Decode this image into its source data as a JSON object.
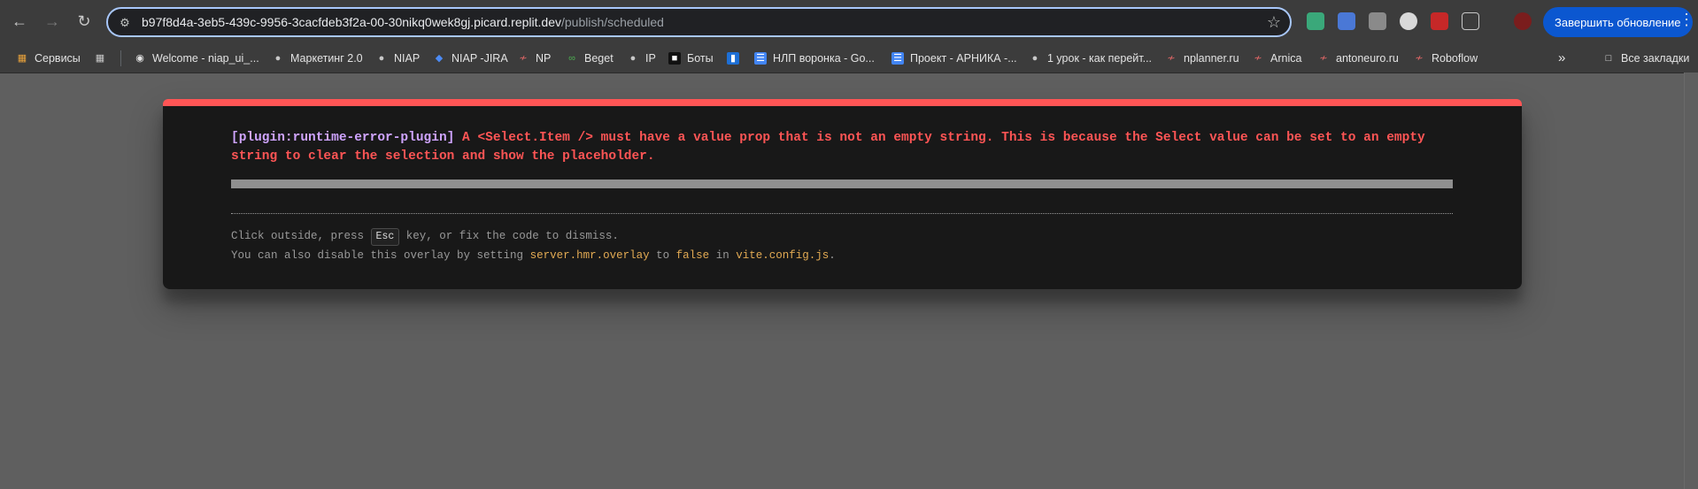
{
  "browser": {
    "url_host": "b97f8d4a-3eb5-439c-9956-3cacfdeb3f2a-00-30nikq0wek8gj.picard.replit.dev",
    "url_path": "/publish/scheduled",
    "update_button": "Завершить обновление"
  },
  "bookmarks": [
    {
      "label": "Сервисы",
      "icon": "apps-grid-icon"
    },
    {
      "label": "",
      "icon": "grid-icon"
    },
    {
      "label": "Welcome - niap_ui_...",
      "icon": "github-icon"
    },
    {
      "label": "Маркетинг 2.0",
      "icon": "globe-icon"
    },
    {
      "label": "NIAP",
      "icon": "globe-icon"
    },
    {
      "label": "NIAP -JIRA",
      "icon": "jira-icon"
    },
    {
      "label": "NP",
      "icon": "link-icon"
    },
    {
      "label": "Beget",
      "icon": "beget-icon"
    },
    {
      "label": "IP",
      "icon": "globe-icon"
    },
    {
      "label": "Боты",
      "icon": "bots-icon"
    },
    {
      "label": "",
      "icon": "trello-icon"
    },
    {
      "label": "НЛП воронка - Go...",
      "icon": "docs-icon"
    },
    {
      "label": "Проект - АРНИКА -...",
      "icon": "docs-icon"
    },
    {
      "label": "1 урок - как перейт...",
      "icon": "globe-icon"
    },
    {
      "label": "nplanner.ru",
      "icon": "link-icon"
    },
    {
      "label": "Arnica",
      "icon": "link-icon"
    },
    {
      "label": "antoneuro.ru",
      "icon": "link-icon"
    },
    {
      "label": "Roboflow",
      "icon": "link-icon"
    }
  ],
  "all_bookmarks": "Все закладки",
  "error_overlay": {
    "plugin": "[plugin:runtime-error-plugin]",
    "message": "A <Select.Item /> must have a value prop that is not an empty string. This is because the Select value can be set to an empty string to clear the selection and show the placeholder.",
    "tip1_before": "Click outside, press",
    "tip1_key": "Esc",
    "tip1_after": "key, or fix the code to dismiss.",
    "tip2_before": "You can also disable this overlay by setting",
    "tip2_code1": "server.hmr.overlay",
    "tip2_mid": "to",
    "tip2_code2": "false",
    "tip2_in": "in",
    "tip2_code3": "vite.config.js",
    "tip2_end": "."
  }
}
